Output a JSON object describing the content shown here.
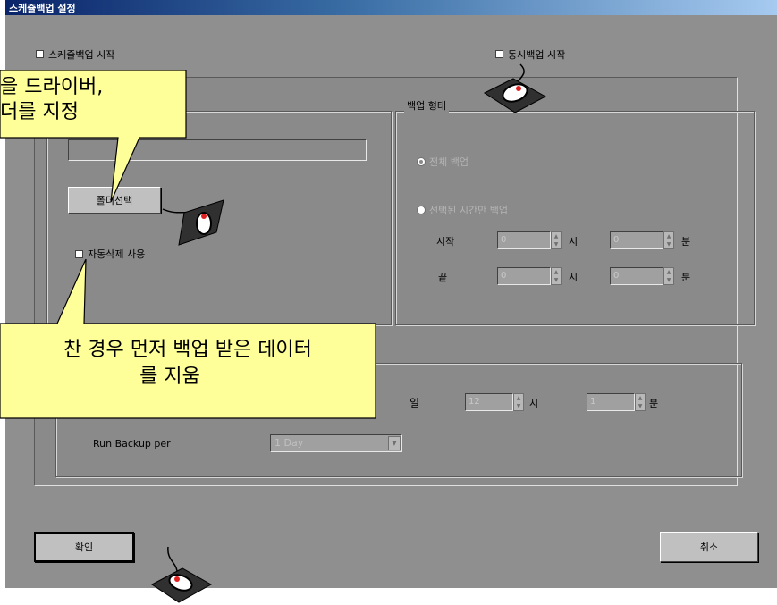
{
  "window": {
    "title": "스케쥴백업 설정"
  },
  "top_options": {
    "schedule_backup_label": "스케쥴백업 시작",
    "simultaneous_backup_label": "동시백업 시작"
  },
  "folder_group": {
    "folder_button": "폴더선택",
    "auto_delete_label": "자동삭제 사용"
  },
  "backup_type": {
    "title": "백업 형태",
    "full_backup": "전체 백업",
    "selected_time_backup": "선택된 시간만 백업",
    "start_label": "시작",
    "end_label": "끝",
    "hour_unit": "시",
    "minute_unit": "분",
    "start_hour": "0",
    "start_minute": "0",
    "end_hour": "0",
    "end_minute": "0"
  },
  "schedule": {
    "day_label": "일",
    "hour": "12",
    "hour_unit": "시",
    "minute": "1",
    "minute_unit": "분",
    "run_backup_label": "Run Backup per",
    "run_backup_value": "1 Day"
  },
  "buttons": {
    "ok": "확인",
    "cancel": "취소"
  },
  "callouts": {
    "top_line1": "을 드라이버,",
    "top_line2": "더를 지정",
    "bottom_line1": "찬 경우 먼저 백업 받은 데이터",
    "bottom_line2": "를 지움"
  }
}
